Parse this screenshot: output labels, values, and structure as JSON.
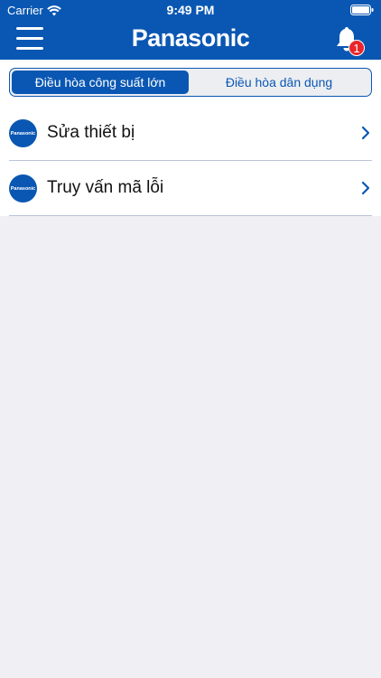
{
  "status": {
    "carrier": "Carrier",
    "time": "9:49 PM"
  },
  "header": {
    "brand": "Panasonic",
    "notification_count": "1"
  },
  "tabs": [
    {
      "label": "Điều hòa công suất lớn",
      "active": true
    },
    {
      "label": "Điều hòa dân dụng",
      "active": false
    }
  ],
  "menu": [
    {
      "logo": "Panasonic",
      "label": "Sửa thiết bị"
    },
    {
      "logo": "Panasonic",
      "label": "Truy vấn mã lỗi"
    }
  ],
  "colors": {
    "primary": "#0a57b3",
    "badge": "#e8262b",
    "background": "#efeff4"
  }
}
